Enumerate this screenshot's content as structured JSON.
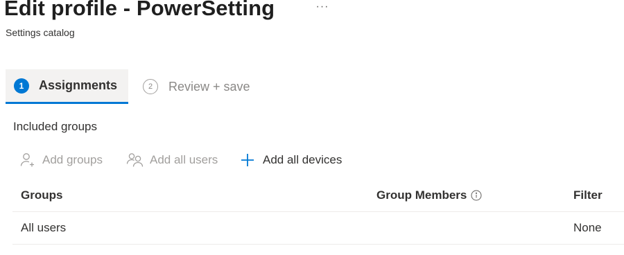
{
  "header": {
    "title": "Edit profile - PowerSetting",
    "more_label": "···",
    "subtitle": "Settings catalog"
  },
  "wizard": {
    "steps": [
      {
        "number": "1",
        "label": "Assignments",
        "state": "active"
      },
      {
        "number": "2",
        "label": "Review + save",
        "state": "inactive"
      }
    ]
  },
  "included_groups": {
    "section_label": "Included groups",
    "toolbar": [
      {
        "label": "Add groups",
        "icon": "person-add-icon",
        "enabled": false
      },
      {
        "label": "Add all users",
        "icon": "people-icon",
        "enabled": false
      },
      {
        "label": "Add all devices",
        "icon": "plus-icon",
        "enabled": true
      }
    ],
    "table": {
      "columns": [
        "Groups",
        "Group Members",
        "Filter"
      ],
      "columns_info_icon": "info-icon",
      "rows": [
        {
          "group": "All users",
          "members": "",
          "filter": "None"
        }
      ]
    }
  },
  "colors": {
    "accent": "#0078d4",
    "disabled_text": "#a19f9d",
    "active_step_bg": "#f3f2f1"
  }
}
